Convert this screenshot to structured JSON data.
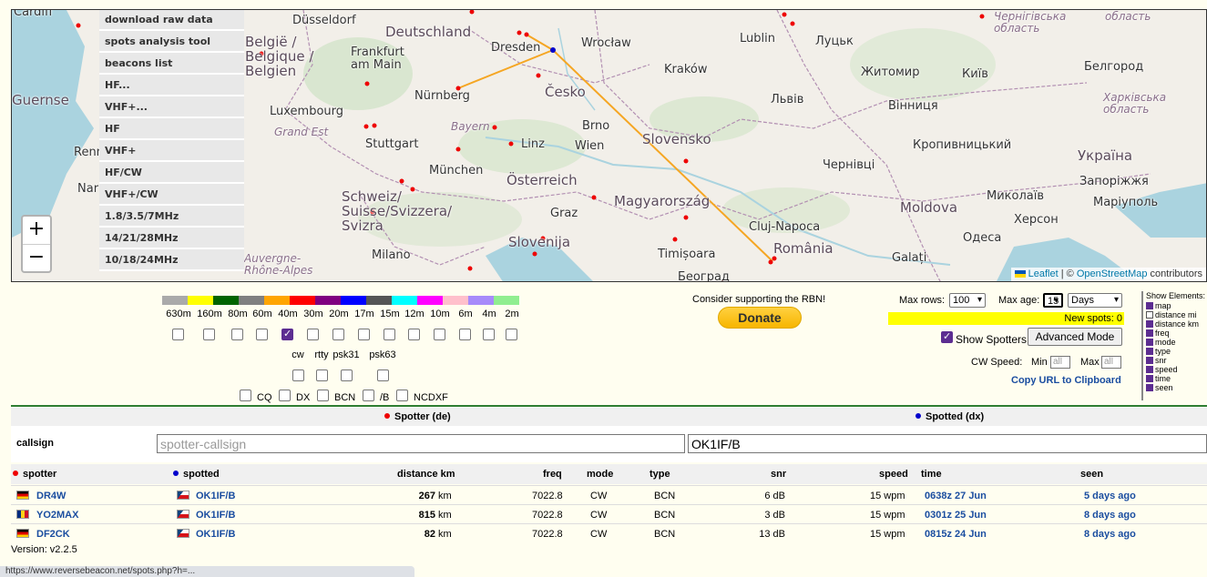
{
  "map": {
    "menu": [
      "download raw data",
      "spots analysis tool",
      "beacons list",
      "HF...",
      "VHF+...",
      "HF",
      "VHF+",
      "HF/CW",
      "VHF+/CW",
      "1.8/3.5/7MHz",
      "14/21/28MHz",
      "10/18/24MHz"
    ],
    "zoom_in": "+",
    "zoom_out": "−",
    "attribution": {
      "leaflet": "Leaflet",
      "sep": " | © ",
      "osm": "OpenStreetMap",
      "suffix": " contributors"
    },
    "places": {
      "cardiff": "Cardiff",
      "dusseldorf": "Düsseldorf",
      "deutschland": "Deutschland",
      "belgie": "België /\nBelgique /\nBelgien",
      "frankfurt": "Frankfurt\nam Main",
      "dresden": "Dresden",
      "wroclaw": "Wrocław",
      "lublin": "Lublin",
      "lutsk": "Луцьк",
      "chernihiv": "Чернігівська\nобласть",
      "oblast": "область",
      "guernsey": "Guernse",
      "nurnberg": "Nürnberg",
      "cesko": "Česko",
      "krakow": "Kraków",
      "zhytomyr": "Житомир",
      "kyiv": "Київ",
      "bilhorod": "Белгород",
      "kharkiv": "Харківська\nобласть",
      "luxembourg": "Luxembourg",
      "bayern": "Bayern",
      "brno": "Brno",
      "lviv": "Львів",
      "vinnytsia": "Вінниця",
      "grandest": "Grand Est",
      "stuttgart": "Stuttgart",
      "linz": "Linz",
      "wien": "Wien",
      "slovensko": "Slovensko",
      "kropyvnytskyi": "Кропивницький",
      "ukraina": "Україна",
      "rennes": "Renn",
      "munchen": "München",
      "chernivtsi": "Чернівці",
      "zaporizhzhia": "Запоріжжя",
      "osterreich": "Österreich",
      "nantes": "Nar",
      "schweiz": "Schweiz/\nSuisse/Svizzera/\nSvizra",
      "magyarorszag": "Magyarország",
      "mykolaiv": "Миколаїв",
      "mariupol": "Маріуполь",
      "graz": "Graz",
      "clujnapoca": "Cluj-Napoca",
      "moldova": "Moldova",
      "kherson": "Херсон",
      "slovenija": "Slovenija",
      "romania": "România",
      "odesa": "Одеса",
      "milano": "Milano",
      "timisoara": "Timișoara",
      "galati": "Galați",
      "auvergne": "Auvergne-\nRhône-Alpes",
      "beograd": "Београд"
    }
  },
  "bands": {
    "colors": [
      "#aaaaaa",
      "#ffff00",
      "#006400",
      "#808080",
      "#ffa500",
      "#ff0000",
      "#800080",
      "#0000ff",
      "#555555",
      "#00ffff",
      "#ff00ff",
      "#ffc0cb",
      "#a78bfa",
      "#90ee90"
    ],
    "labels": [
      "630m",
      "160m",
      "80m",
      "60m",
      "40m",
      "30m",
      "20m",
      "17m",
      "15m",
      "12m",
      "10m",
      "6m",
      "4m",
      "2m"
    ],
    "checked": [
      false,
      false,
      false,
      false,
      true,
      false,
      false,
      false,
      false,
      false,
      false,
      false,
      false,
      false
    ]
  },
  "modes": {
    "labels": [
      "cw",
      "rtty",
      "psk31",
      "psk63"
    ],
    "checked": [
      false,
      false,
      false,
      false
    ]
  },
  "types": {
    "labels": [
      "CQ",
      "DX",
      "BCN",
      "/B",
      "NCDXF"
    ],
    "checked": [
      false,
      false,
      false,
      false,
      false
    ]
  },
  "donate": {
    "text": "Consider supporting the RBN!",
    "button": "Donate"
  },
  "controls": {
    "max_rows_label": "Max rows:",
    "max_rows_value": "100",
    "max_age_label": "Max age:",
    "max_age_value": "15",
    "max_age_unit": "Days",
    "new_spots": "New spots: 0",
    "show_spotters": "Show Spotters",
    "show_spotters_checked": true,
    "advanced_mode": "Advanced Mode",
    "cw_speed_label": "CW Speed:",
    "min_label": "Min",
    "max_label": "Max",
    "min_placeholder": "all",
    "max_placeholder": "all",
    "copy_url": "Copy URL to Clipboard"
  },
  "show_elements": {
    "title": "Show Elements:",
    "items": [
      {
        "label": "map",
        "checked": true
      },
      {
        "label": "distance mi",
        "checked": false
      },
      {
        "label": "distance km",
        "checked": true
      },
      {
        "label": "freq",
        "checked": true
      },
      {
        "label": "mode",
        "checked": true
      },
      {
        "label": "type",
        "checked": true
      },
      {
        "label": "snr",
        "checked": true
      },
      {
        "label": "speed",
        "checked": true
      },
      {
        "label": "time",
        "checked": true
      },
      {
        "label": "seen",
        "checked": true
      }
    ]
  },
  "filter": {
    "spotter_head": "Spotter (de)",
    "spotted_head": "Spotted (dx)",
    "callsign_label": "callsign",
    "spotter_placeholder": "spotter-callsign",
    "spotted_value": "OK1IF/B"
  },
  "table": {
    "headers": {
      "spotter": "spotter",
      "spotted": "spotted",
      "distance": "distance km",
      "freq": "freq",
      "mode": "mode",
      "type": "type",
      "snr": "snr",
      "speed": "speed",
      "time": "time",
      "seen": "seen"
    },
    "rows": [
      {
        "spotter": "DR4W",
        "spotter_flag": "de",
        "spotted": "OK1IF/B",
        "distance": "267",
        "unit": "km",
        "freq": "7022.8",
        "mode": "CW",
        "type": "BCN",
        "snr": "6 dB",
        "speed": "15 wpm",
        "time": "0638z 27 Jun",
        "seen": "5 days ago"
      },
      {
        "spotter": "YO2MAX",
        "spotter_flag": "ro",
        "spotted": "OK1IF/B",
        "distance": "815",
        "unit": "km",
        "freq": "7022.8",
        "mode": "CW",
        "type": "BCN",
        "snr": "3 dB",
        "speed": "15 wpm",
        "time": "0301z 25 Jun",
        "seen": "8 days ago"
      },
      {
        "spotter": "DF2CK",
        "spotter_flag": "de",
        "spotted": "OK1IF/B",
        "distance": "82",
        "unit": "km",
        "freq": "7022.8",
        "mode": "CW",
        "type": "BCN",
        "snr": "13 dB",
        "speed": "15 wpm",
        "time": "0815z 24 Jun",
        "seen": "8 days ago"
      }
    ]
  },
  "version": "Version: v2.2.5",
  "status_url": "https://www.reversebeacon.net/spots.php?h=..."
}
